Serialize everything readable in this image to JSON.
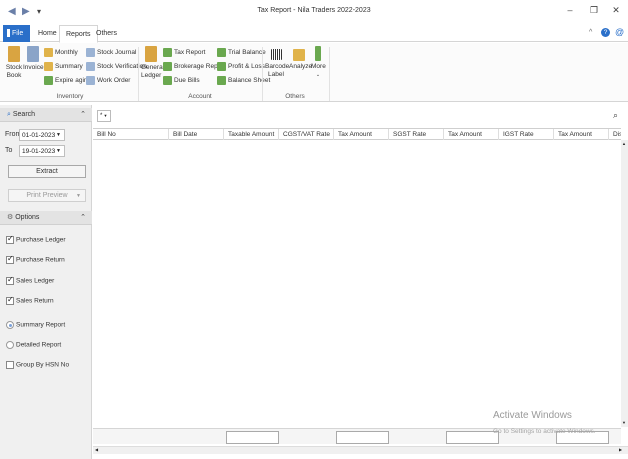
{
  "window": {
    "title": "Tax Report - Nila Traders 2022-2023",
    "back_icon": "◀",
    "forward_icon": "▶",
    "menu_icon": "▾",
    "minimize": "–",
    "restore": "❐",
    "close": "✕"
  },
  "tabs": {
    "file": "File",
    "home": "Home",
    "reports": "Reports",
    "others": "Others"
  },
  "ribbon_right": {
    "collapse": "^",
    "help": "?",
    "about": "@"
  },
  "ribbon": {
    "inventory": {
      "label": "Inventory",
      "stock_book": "Stock Book",
      "stock_book_l1": "Stock",
      "stock_book_l2": "Book",
      "invoice": "Invoice",
      "monthly": "Monthly",
      "summary": "Summary",
      "expire_aging": "Expire aging",
      "stock_journal": "Stock Journal",
      "stock_verification": "Stock Verification",
      "work_order": "Work Order"
    },
    "account": {
      "label": "Account",
      "general_ledger_l1": "General",
      "general_ledger_l2": "Ledger",
      "tax_report": "Tax Report",
      "brokerage_report": "Brokerage Report",
      "due_bills": "Due Bills",
      "trial_balance": "Trial Balance",
      "profit_loss": "Profit & Loss",
      "balance_sheet": "Balance Sheet"
    },
    "others": {
      "label": "Others",
      "barcode_l1": "Barcode",
      "barcode_l2": "Label",
      "analyze": "Analyze",
      "more": "More"
    }
  },
  "search_panel": {
    "title": "Search",
    "from_label": "From",
    "from_value": "01-01-2023",
    "to_label": "To",
    "to_value": "19-01-2023",
    "extract": "Extract",
    "print_preview": "Print Preview"
  },
  "options_panel": {
    "title": "Options",
    "purchase_ledger": "Purchase Ledger",
    "purchase_return": "Purchase Return",
    "sales_ledger": "Sales Ledger",
    "sales_return": "Sales Return",
    "summary_report": "Summary Report",
    "detailed_report": "Detailed Report",
    "group_by_hsn": "Group By HSN No"
  },
  "grid": {
    "filter_value": "*",
    "columns": [
      "Bill No",
      "Bill Date",
      "Taxable Amount",
      "CGST/VAT Rate",
      "Tax Amount",
      "SGST Rate",
      "Tax Amount",
      "IGST Rate",
      "Tax Amount",
      "Dis"
    ]
  },
  "watermark": {
    "line1": "Activate Windows",
    "line2": "Go to Settings to activate Windows."
  },
  "colors": {
    "accent": "#2a6fc9",
    "panel": "#f0f0f0"
  }
}
